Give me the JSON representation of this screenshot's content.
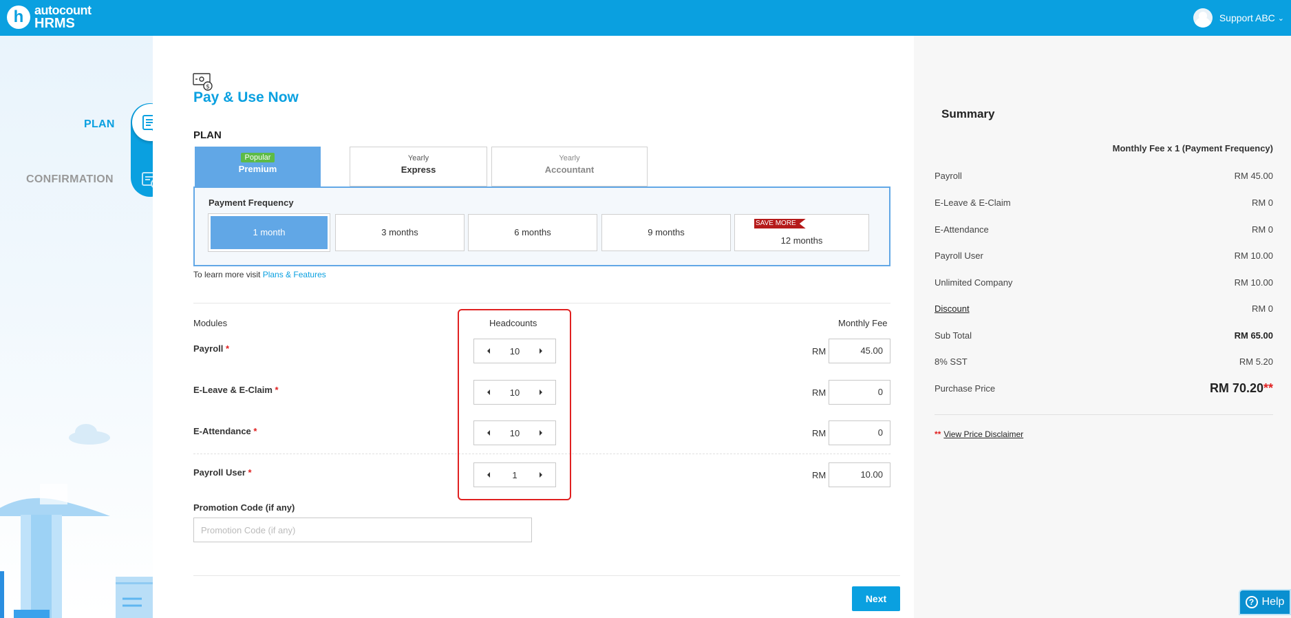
{
  "brand": {
    "line1": "autocount",
    "line2": "HRMS",
    "mark": "h"
  },
  "user": {
    "name": "Support ABC"
  },
  "steps": [
    {
      "label": "PLAN",
      "active": true
    },
    {
      "label": "CONFIRMATION",
      "active": false
    }
  ],
  "page": {
    "title": "Pay & Use Now",
    "plan_heading": "PLAN"
  },
  "plans": [
    {
      "top": "Popular",
      "name": "Premium",
      "active": true
    },
    {
      "top": "Yearly",
      "name": "Express",
      "active": false
    },
    {
      "top": "Yearly",
      "name": "Accountant",
      "active": false,
      "muted": true
    }
  ],
  "payment_frequency": {
    "title": "Payment Frequency",
    "options": [
      "1 month",
      "3 months",
      "6 months",
      "9 months",
      "12 months"
    ],
    "selected": "1 month",
    "save_flag": "SAVE MORE"
  },
  "learn_more": {
    "text": "To learn more visit ",
    "link": "Plans & Features"
  },
  "modules_table": {
    "headers": {
      "modules": "Modules",
      "headcounts": "Headcounts",
      "monthly_fee": "Monthly Fee"
    },
    "currency": "RM",
    "rows": [
      {
        "name": "Payroll",
        "required": "*",
        "headcount": "10",
        "fee": "45.00"
      },
      {
        "name": "E-Leave & E-Claim",
        "required": "*",
        "headcount": "10",
        "fee": "0"
      },
      {
        "name": "E-Attendance",
        "required": "*",
        "headcount": "10",
        "fee": "0"
      },
      {
        "name": "Payroll User",
        "required": "*",
        "headcount": "1",
        "fee": "10.00"
      }
    ]
  },
  "promo": {
    "label": "Promotion Code (if any)",
    "placeholder": "Promotion Code (if any)",
    "value": ""
  },
  "next_button": "Next",
  "summary": {
    "title": "Summary",
    "subtitle": "Monthly Fee x 1 (Payment Frequency)",
    "rows": [
      {
        "label": "Payroll",
        "value": "RM 45.00"
      },
      {
        "label": "E-Leave & E-Claim",
        "value": "RM 0"
      },
      {
        "label": "E-Attendance",
        "value": "RM 0"
      },
      {
        "label": "Payroll User",
        "value": "RM 10.00"
      },
      {
        "label": "Unlimited Company",
        "value": "RM 10.00"
      },
      {
        "label": "Discount",
        "value": "RM 0"
      },
      {
        "label": "Sub Total",
        "value": "RM 65.00"
      },
      {
        "label": "8% SST",
        "value": "RM 5.20"
      }
    ],
    "purchase_price": {
      "label": "Purchase Price",
      "value": "RM 70.20",
      "mark": "**"
    },
    "disclaimer": {
      "stars": "**",
      "link": "View Price Disclaimer"
    }
  },
  "help": {
    "label": "Help"
  },
  "colors": {
    "brand": "#0aa0e0",
    "selected": "#61a7e6",
    "popular": "#5dbb46",
    "highlight": "#e02020",
    "save_flag": "#b51a1a"
  }
}
